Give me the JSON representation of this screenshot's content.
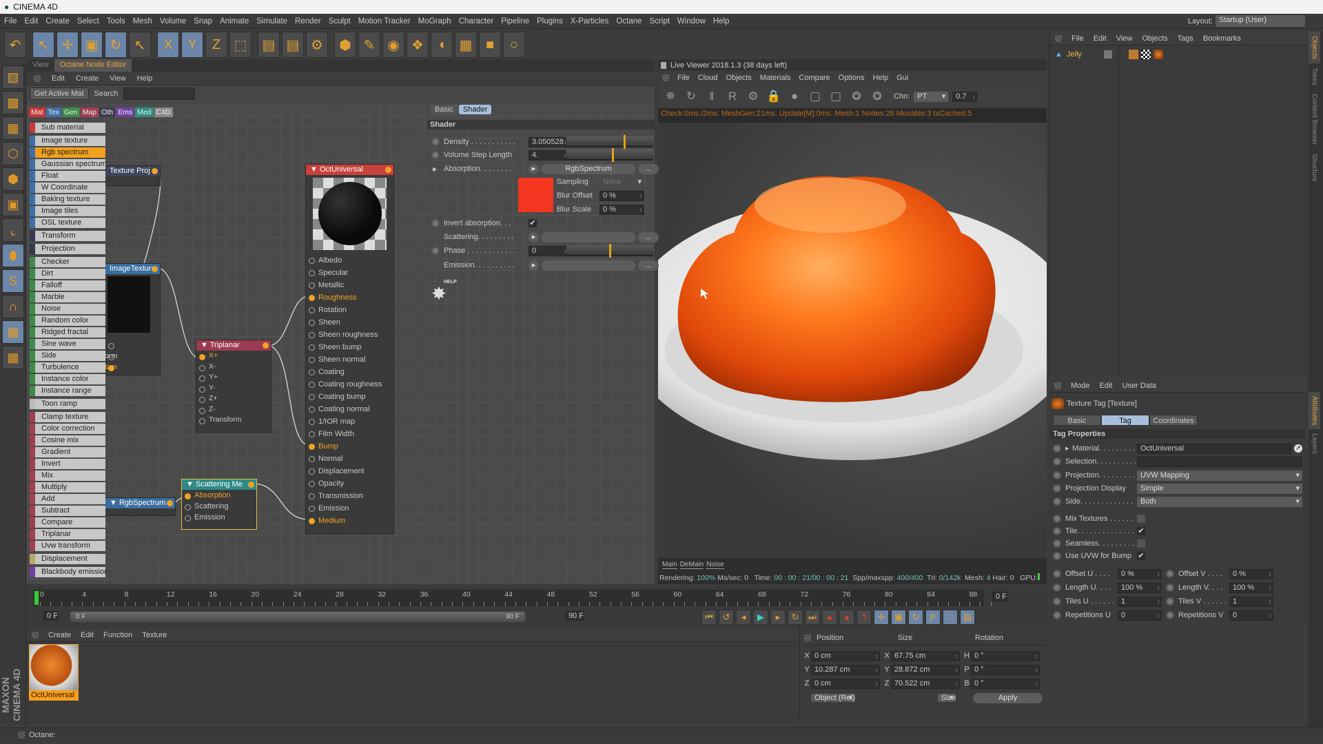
{
  "app": {
    "title": "CINEMA 4D"
  },
  "menu": [
    "File",
    "Edit",
    "Create",
    "Select",
    "Tools",
    "Mesh",
    "Volume",
    "Snap",
    "Animate",
    "Simulate",
    "Render",
    "Sculpt",
    "Motion Tracker",
    "MoGraph",
    "Character",
    "Pipeline",
    "Plugins",
    "X-Particles",
    "Octane",
    "Script",
    "Window",
    "Help"
  ],
  "layout": {
    "label": "Layout:",
    "value": "Startup (User)"
  },
  "toolbar": [
    {
      "icon": "undo-icon",
      "glyph": "↶"
    },
    {
      "icon": "live-selection-icon",
      "glyph": "↖",
      "on": true
    },
    {
      "icon": "move-icon",
      "glyph": "✛",
      "on": true
    },
    {
      "icon": "scale-icon",
      "glyph": "▣",
      "on": true
    },
    {
      "icon": "rotate-icon",
      "glyph": "↻",
      "on": true
    },
    {
      "icon": "last-tool-icon",
      "glyph": "↖"
    },
    {
      "icon": "x-axis-icon",
      "glyph": "X",
      "on": true
    },
    {
      "icon": "y-axis-icon",
      "glyph": "Y",
      "on": true
    },
    {
      "icon": "z-axis-icon",
      "glyph": "Z"
    },
    {
      "icon": "coordinate-system-icon",
      "glyph": "⬚"
    },
    {
      "icon": "render-view-icon",
      "glyph": "▤"
    },
    {
      "icon": "render-picture-viewer-icon",
      "glyph": "▤"
    },
    {
      "icon": "render-settings-icon",
      "glyph": "⚙"
    },
    {
      "icon": "cube-icon",
      "glyph": "⬢"
    },
    {
      "icon": "pen-icon",
      "glyph": "✎"
    },
    {
      "icon": "subdivision-icon",
      "glyph": "◉"
    },
    {
      "icon": "cloner-icon",
      "glyph": "❖"
    },
    {
      "icon": "deformer-icon",
      "glyph": "◖"
    },
    {
      "icon": "floor-icon",
      "glyph": "▦"
    },
    {
      "icon": "camera-icon",
      "glyph": "■"
    },
    {
      "icon": "light-icon",
      "glyph": "○"
    }
  ],
  "left_tools": [
    "make-editable-icon",
    "model-mode-icon",
    "texture-mode-icon",
    "points-mode-icon",
    "edges-mode-icon",
    "polygons-mode-icon",
    "axis-icon",
    "tweak-icon",
    "solo-icon",
    "snap-icon",
    "workplane-lock-icon",
    "workplane-icon"
  ],
  "node_editor": {
    "tabs": [
      "View",
      "Octane Node Editor"
    ],
    "menu": [
      "Edit",
      "Create",
      "View",
      "Help"
    ],
    "get_active_mat": "Get Active Mat",
    "search_label": "Search",
    "search_value": "",
    "categories": [
      {
        "label": "Mat",
        "color": "#c8383a"
      },
      {
        "label": "Tex",
        "color": "#3f6fa6"
      },
      {
        "label": "Gen",
        "color": "#3f8a4a"
      },
      {
        "label": "Map",
        "color": "#a04050"
      },
      {
        "label": "Oth",
        "color": "#3a3f50"
      },
      {
        "label": "Ems",
        "color": "#7040a0"
      },
      {
        "label": "Med",
        "color": "#2f9080"
      },
      {
        "label": "C4D",
        "color": "#8a8a8a"
      }
    ],
    "list": [
      {
        "label": "Sub material",
        "color": "#c8383a"
      },
      {
        "label": "Image texture",
        "color": "#3f6fa6",
        "gap": true
      },
      {
        "label": "Rgb spectrum",
        "color": "#3f6fa6",
        "selected": true
      },
      {
        "label": "Gaussian spectrum",
        "color": "#3f6fa6"
      },
      {
        "label": "Float",
        "color": "#3f6fa6"
      },
      {
        "label": "W Coordinate",
        "color": "#3f6fa6"
      },
      {
        "label": "Baking texture",
        "color": "#3f6fa6"
      },
      {
        "label": "Image tiles",
        "color": "#3f6fa6"
      },
      {
        "label": "OSL texture",
        "color": "#3f6fa6"
      },
      {
        "label": "Transform",
        "color": "#343a4a",
        "gap": true
      },
      {
        "label": "Projection",
        "color": "#343a4a",
        "gap": true
      },
      {
        "label": "Checker",
        "color": "#3f8a4a",
        "gap": true
      },
      {
        "label": "Dirt",
        "color": "#3f8a4a"
      },
      {
        "label": "Falloff",
        "color": "#3f8a4a"
      },
      {
        "label": "Marble",
        "color": "#3f8a4a"
      },
      {
        "label": "Noise",
        "color": "#3f8a4a"
      },
      {
        "label": "Random color",
        "color": "#3f8a4a"
      },
      {
        "label": "Ridged fractal",
        "color": "#3f8a4a"
      },
      {
        "label": "Sine wave",
        "color": "#3f8a4a"
      },
      {
        "label": "Side",
        "color": "#3f8a4a"
      },
      {
        "label": "Turbulence",
        "color": "#3f8a4a"
      },
      {
        "label": "Instance color",
        "color": "#3f8a4a"
      },
      {
        "label": "Instance range",
        "color": "#3f8a4a"
      },
      {
        "label": "Toon ramp",
        "color": "#bbbbbb",
        "gap": true
      },
      {
        "label": "Clamp texture",
        "color": "#a04050",
        "gap": true
      },
      {
        "label": "Color correction",
        "color": "#a04050"
      },
      {
        "label": "Cosine mix",
        "color": "#a04050"
      },
      {
        "label": "Gradient",
        "color": "#a04050"
      },
      {
        "label": "Invert",
        "color": "#a04050"
      },
      {
        "label": "Mix",
        "color": "#a04050"
      },
      {
        "label": "Multiply",
        "color": "#a04050"
      },
      {
        "label": "Add",
        "color": "#a04050"
      },
      {
        "label": "Subtract",
        "color": "#a04050"
      },
      {
        "label": "Compare",
        "color": "#a04050"
      },
      {
        "label": "Triplanar",
        "color": "#a04050"
      },
      {
        "label": "Uvw transform",
        "color": "#a04050"
      },
      {
        "label": "Displacement",
        "color": "#b8a86a",
        "gap": true
      },
      {
        "label": "Blackbody emission",
        "color": "#7040a0",
        "gap": true
      }
    ],
    "nodes": {
      "texture_proj": {
        "title": "Texture Proj",
        "color": "#3b4458"
      },
      "image_texture": {
        "title": "ImageTexture",
        "color": "#3a6e9e",
        "ports": [
          {
            "label": "Power"
          },
          {
            "label": "Transform"
          },
          {
            "label": "Projection",
            "active": true
          }
        ]
      },
      "triplanar": {
        "title": "Triplanar",
        "color": "#9c3a52",
        "ports": [
          {
            "label": "X+",
            "active": true
          },
          {
            "label": "X-"
          },
          {
            "label": "Y+"
          },
          {
            "label": "Y-"
          },
          {
            "label": "Z+"
          },
          {
            "label": "Z-"
          },
          {
            "label": "Transform"
          }
        ]
      },
      "oct_universal": {
        "title": "OctUniversal",
        "color": "#c8423a",
        "ports": [
          {
            "label": "Albedo"
          },
          {
            "label": "Specular"
          },
          {
            "label": "Metallic"
          },
          {
            "label": "Roughness",
            "active": true
          },
          {
            "label": "Rotation"
          },
          {
            "label": "Sheen"
          },
          {
            "label": "Sheen roughness"
          },
          {
            "label": "Sheen bump"
          },
          {
            "label": "Sheen normal"
          },
          {
            "label": "Coating"
          },
          {
            "label": "Coating roughness"
          },
          {
            "label": "Coating bump"
          },
          {
            "label": "Coating normal"
          },
          {
            "label": "1/IOR map"
          },
          {
            "label": "Film Width"
          },
          {
            "label": "Bump",
            "active": true
          },
          {
            "label": "Normal"
          },
          {
            "label": "Displacement"
          },
          {
            "label": "Opacity"
          },
          {
            "label": "Transmission"
          },
          {
            "label": "Emission"
          },
          {
            "label": "Medium",
            "active": true
          }
        ]
      },
      "scattering": {
        "title": "Scattering Me",
        "color": "#2f8a86",
        "ports": [
          {
            "label": "Absorption",
            "active": true
          },
          {
            "label": "Scattering"
          },
          {
            "label": "Emission"
          }
        ]
      },
      "rgb_spectrum": {
        "title": "RgbSpectrum",
        "color": "#3a6e9e"
      }
    }
  },
  "shader_panel": {
    "tabs": [
      "Basic",
      "Shader"
    ],
    "active_tab": "Shader",
    "section": "Shader",
    "density": {
      "label": "Density . . . . . . . . . . .",
      "value": "3.050528"
    },
    "volume_step": {
      "label": "Volume Step Length",
      "value": "4."
    },
    "absorption": {
      "label": "Absorption. . . . . . . .",
      "shader": "RgbSpectrum",
      "more": "...",
      "swatch": "#f2361f",
      "sampling": {
        "label": "Sampling",
        "value": "None"
      },
      "blur_offset": {
        "label": "Blur Offset",
        "value": "0 %"
      },
      "blur_scale": {
        "label": "Blur Scale",
        "value": "0 %"
      }
    },
    "invert_absorption": {
      "label": "Invert absorption. . .",
      "checked": true
    },
    "scattering": {
      "label": "Scattering. . . . . . . . .",
      "more": "..."
    },
    "phase": {
      "label": "Phase . . . . . . . . . . . .",
      "value": "0"
    },
    "emission": {
      "label": "Emission. . . . . . . . . .",
      "more": "..."
    },
    "help": "HELP"
  },
  "live_viewer": {
    "title": "Live Viewer 2018.1.3 (38 days left)",
    "menu": [
      "File",
      "Cloud",
      "Objects",
      "Materials",
      "Compare",
      "Options",
      "Help",
      "Gui"
    ],
    "toolbar_icons": [
      "send-scene-icon",
      "restart-icon",
      "pause-icon",
      "region-render-icon",
      "settings-icon",
      "lock-icon",
      "material-ball-icon",
      "clay-mode-icon",
      "frame-icon",
      "pick-focus-icon",
      "pick-material-icon"
    ],
    "channel_label": "Chn:",
    "channel_value": "PT",
    "gamma_value": "0.7",
    "stats": "Check:0ms./2ms. MeshGen:21ms. Update[M]:0ms. Mesh:1 Nodes:26 Movable:3 txCached:5",
    "bottom_tabs": [
      "Main",
      "DeMain",
      "Noise"
    ],
    "status": {
      "rendering_label": "Rendering:",
      "rendering": "100%",
      "mssec_label": "Ms/sec:",
      "mssec": "0",
      "time_label": "Time:",
      "time": "00 : 00 : 21/00 : 00 : 21",
      "spp_label": "Spp/maxspp:",
      "spp": "400/400",
      "tri_label": "Tri:",
      "tri": "0/142k",
      "mesh_label": "Mesh:",
      "mesh": "4",
      "hair_label": "Hair:",
      "hair": "0",
      "gpu_label": "GPU:"
    }
  },
  "object_manager": {
    "menu": [
      "File",
      "Edit",
      "View",
      "Objects",
      "Tags",
      "Bookmarks"
    ],
    "objects": [
      {
        "name": "Jelly",
        "tags": [
          "phong-tag-icon",
          "checker-tag-icon",
          "texture-tag-icon"
        ]
      }
    ]
  },
  "right_tabs": [
    "Objects",
    "Takes",
    "Content Browser",
    "Structure",
    "Attributes",
    "Layers"
  ],
  "attributes": {
    "menu": [
      "Mode",
      "Edit",
      "User Data"
    ],
    "title": "Texture Tag [Texture]",
    "tabs": [
      "Basic",
      "Tag",
      "Coordinates"
    ],
    "active_tab": "Tag",
    "section": "Tag Properties",
    "material": {
      "label": "Material. . . . . . . . .",
      "value": "OctUniversal"
    },
    "selection": {
      "label": "Selection. . . . . . . . . .",
      "value": ""
    },
    "projection": {
      "label": "Projection. . . . . . . . .",
      "value": "UVW Mapping"
    },
    "projection_display": {
      "label": "Projection Display",
      "value": "Simple"
    },
    "side": {
      "label": "Side. . . . . . . . . . . . . .",
      "value": "Both"
    },
    "mix_textures": {
      "label": "Mix Textures . . . . . . .",
      "checked": false
    },
    "tile": {
      "label": "Tile. . . . . . . . . . . . . .",
      "checked": true
    },
    "seamless": {
      "label": "Seamless. . . . . . . . . .",
      "checked": false
    },
    "use_uvw_bump": {
      "label": "Use UVW for Bump",
      "checked": true
    },
    "pairs": [
      {
        "l": "Offset U . . . .",
        "lv": "0 %",
        "r": "Offset V . . . .",
        "rv": "0 %"
      },
      {
        "l": "Length U. . . .",
        "lv": "100 %",
        "r": "Length V. . . .",
        "rv": "100 %"
      },
      {
        "l": "Tiles U . . . . . .",
        "lv": "1",
        "r": "Tiles V . . . . . .",
        "rv": "1"
      },
      {
        "l": "Repetitions U",
        "lv": "0",
        "r": "Repetitions V",
        "rv": "0"
      }
    ]
  },
  "timeline": {
    "ticks": [
      "0",
      "4",
      "8",
      "12",
      "16",
      "20",
      "24",
      "28",
      "32",
      "36",
      "40",
      "44",
      "48",
      "52",
      "56",
      "60",
      "64",
      "68",
      "72",
      "76",
      "80",
      "84",
      "88"
    ],
    "current_frame": "0 F",
    "start": "0 F",
    "range_start": "0 F",
    "range_end": "90 F",
    "end": "90 F",
    "playback_icons": [
      "go-to-start-icon",
      "previous-key-icon",
      "previous-frame-icon",
      "play-icon",
      "next-frame-icon",
      "next-key-icon",
      "go-to-end-icon",
      "record-icon",
      "autokey-icon",
      "keyframe-selection-icon",
      "position-key-icon",
      "scale-key-icon",
      "rotation-key-icon",
      "parameter-key-icon",
      "point-level-icon",
      "timeline-icon"
    ]
  },
  "material_manager": {
    "menu": [
      "Create",
      "Edit",
      "Function",
      "Texture"
    ],
    "materials": [
      {
        "name": "OctUniversal",
        "selected": true
      }
    ]
  },
  "coordinates": {
    "headers": [
      "Position",
      "Size",
      "Rotation"
    ],
    "rows": [
      {
        "pa": "X",
        "p": "0 cm",
        "sa": "X",
        "s": "67.75 cm",
        "ra": "H",
        "r": "0 °"
      },
      {
        "pa": "Y",
        "p": "10.287 cm",
        "sa": "Y",
        "s": "28.872 cm",
        "ra": "P",
        "r": "0 °"
      },
      {
        "pa": "Z",
        "p": "0 cm",
        "sa": "Z",
        "s": "70.522 cm",
        "ra": "B",
        "r": "0 °"
      }
    ],
    "mode": "Object (Rel)",
    "size_mode": "Size",
    "apply": "Apply"
  },
  "branding": {
    "logo": "MAXON CINEMA 4D"
  },
  "status_bar": {
    "text": "Octane:"
  }
}
